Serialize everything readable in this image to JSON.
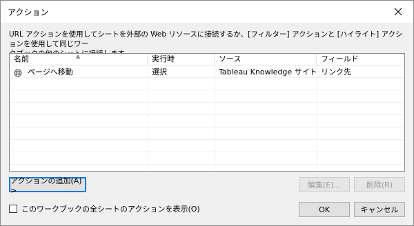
{
  "window": {
    "title": "アクション",
    "close_icon": "close-icon"
  },
  "description": {
    "line1": "URL アクションを使用してシートを外部の Web リソースに接続するか、[フィルター] アクションと [ハイライト] アクションを使用して同じワー",
    "line2": "クブックの他のシートに接続します。"
  },
  "table": {
    "columns": [
      "名前",
      "実行時",
      "ソース",
      "フィールド"
    ],
    "rows": [
      {
        "icon": "globe-icon",
        "name": "ページへ移動",
        "run_on": "選択",
        "source": "Tableau Knowledge サイトマ...",
        "field": "リンク先"
      }
    ]
  },
  "buttons": {
    "add_action": "アクションの追加(A) >",
    "edit": "編集(E)...",
    "delete": "削除(R)",
    "ok": "OK",
    "cancel": "キャンセル"
  },
  "checkbox": {
    "label": "このワークブックの全シートのアクションを表示(O)",
    "checked": false
  }
}
